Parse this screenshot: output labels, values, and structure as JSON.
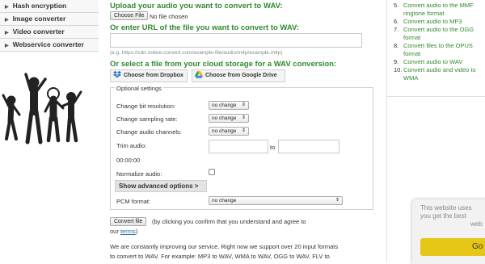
{
  "left_nav": {
    "items": [
      {
        "label": "Hash encryption"
      },
      {
        "label": "Image converter"
      },
      {
        "label": "Video converter"
      },
      {
        "label": "Webservice converter"
      }
    ]
  },
  "upload": {
    "heading": "Upload your audio you want to convert to WAV:",
    "choose_file_label": "Choose File",
    "no_file_text": "No file chosen"
  },
  "url": {
    "heading": "Or enter URL of the file you want to convert to WAV:",
    "value": "",
    "example": "(e.g. https://cdn.online-convert.com/example-file/audio/m4p/example.m4p)"
  },
  "cloud": {
    "heading": "Or select a file from your cloud storage for a WAV conversion:",
    "dropbox_label": "Choose from Dropbox",
    "gdrive_label": "Choose from Google Drive"
  },
  "options": {
    "legend": "Optional settings",
    "bit_resolution": {
      "label": "Change bit resolution:",
      "value": "no change"
    },
    "sampling_rate": {
      "label": "Change sampling rate:",
      "value": "no change"
    },
    "audio_channels": {
      "label": "Change audio channels:",
      "value": "no change"
    },
    "trim": {
      "label": "Trim audio:",
      "from": "",
      "to_label": "to",
      "to": "",
      "default_time": "00:00:00"
    },
    "normalize": {
      "label": "Normalize audio:",
      "checked": false
    },
    "advanced_label": "Show advanced options >",
    "pcm": {
      "label": "PCM format:",
      "value": "no change"
    }
  },
  "convert": {
    "button_label": "Convert file",
    "consent_text": "(by clicking you confirm that you understand and agree to",
    "our_text": "our",
    "terms_link": "terms",
    "terms_suffix": ")"
  },
  "info": {
    "line1": "We are constantly improving our service. Right now we support over 20 input formats",
    "line2": "to convert to WAV. For example: MP3 to WAV, WMA to WAV, OGG to WAV, FLV to"
  },
  "right_list": [
    {
      "num": "5.",
      "text": "Convert audio to the MMF ringtone format"
    },
    {
      "num": "6.",
      "text": "Convert audio to MP3"
    },
    {
      "num": "7.",
      "text": "Convert audio to the OGG format"
    },
    {
      "num": "8.",
      "text": "Convert files to the OPUS format"
    },
    {
      "num": "9.",
      "text": "Convert audio to WAV"
    },
    {
      "num": "10.",
      "text": "Convert audio and video to WMA"
    }
  ],
  "cookie": {
    "line1": "This website uses",
    "line2": "you get the best",
    "line3": "web",
    "button_label": "Go"
  },
  "colors": {
    "green": "#2f8a2f",
    "link": "#2f6faa",
    "cookie_button": "#e6c717"
  }
}
